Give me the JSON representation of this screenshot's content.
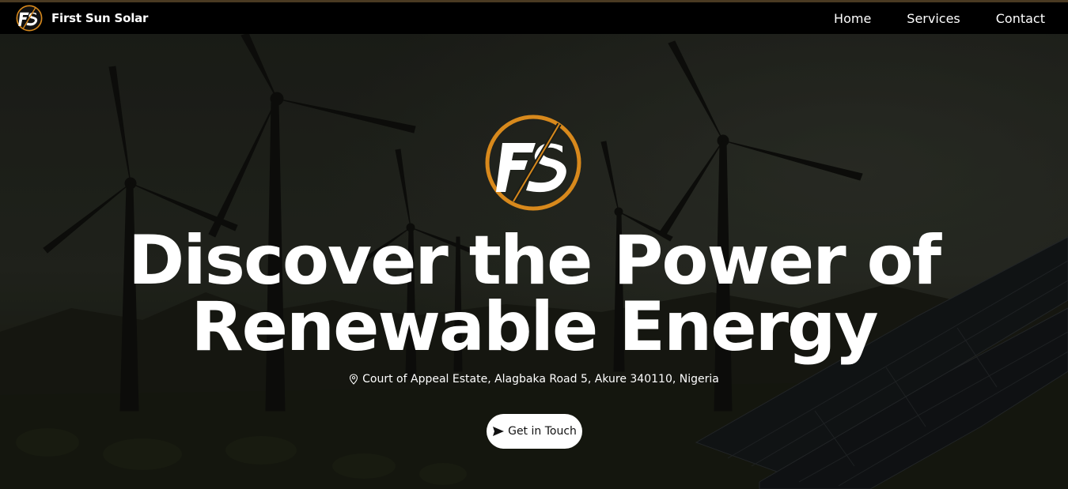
{
  "brand": {
    "name": "First Sun Solar",
    "logo_letters": "FS"
  },
  "nav": {
    "items": [
      {
        "label": "Home"
      },
      {
        "label": "Services"
      },
      {
        "label": "Contact"
      }
    ]
  },
  "hero": {
    "title_line1": "Discover the Power of",
    "title_line2": "Renewable Energy",
    "address": "Court of Appeal Estate, Alagbaka Road 5, Akure 340110, Nigeria",
    "cta_label": "Get in Touch"
  },
  "icons": {
    "location": "map-pin-icon",
    "send": "paper-plane-icon"
  },
  "colors": {
    "accent": "#d8891c",
    "nav_bg": "#000000",
    "overlay": "#1b1d17",
    "text": "#ffffff"
  }
}
